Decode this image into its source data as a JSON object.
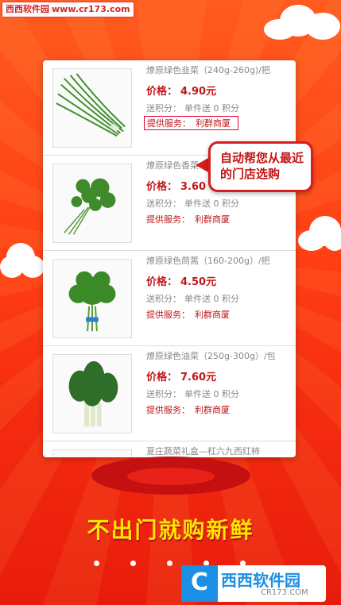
{
  "watermark": {
    "brand": "西西软件园",
    "site": "www.cr173.com"
  },
  "products": [
    {
      "name": "燎原绿色韭菜（240g-260g)/把",
      "price_label": "价格：",
      "price": "4.90元",
      "points_label": "送积分：",
      "points_value": "单件送 0 积分",
      "service_label": "提供服务：",
      "service_value": "利群商厦",
      "image_icon": "chives-image"
    },
    {
      "name": "燎原绿色香菜",
      "price_label": "价格：",
      "price": "3.60",
      "points_label": "送积分：",
      "points_value": "单件送 0 积分",
      "service_label": "提供服务：",
      "service_value": "利群商厦",
      "image_icon": "cilantro-image"
    },
    {
      "name": "燎原绿色茼蒿（160-200g）/把",
      "price_label": "价格：",
      "price": "4.50元",
      "points_label": "送积分：",
      "points_value": "单件送 0 积分",
      "service_label": "提供服务：",
      "service_value": "利群商厦",
      "image_icon": "crown-daisy-image"
    },
    {
      "name": "燎原绿色油菜（250g-300g）/包",
      "price_label": "价格：",
      "price": "7.60元",
      "points_label": "送积分：",
      "points_value": "单件送 0 积分",
      "service_label": "提供服务：",
      "service_value": "利群商厦",
      "image_icon": "bok-choy-image"
    },
    {
      "name": "夏庄蔬菜礼盒—杠六九西红柿",
      "image_icon": "gift-box-image"
    }
  ],
  "bubble": {
    "text": "自动帮您从最近的门店选购"
  },
  "slogan": "不出门就购新鲜",
  "pagination": {
    "count": 5,
    "active_index": 3
  },
  "footer_logo": {
    "mark": "C",
    "text": "西西软件园",
    "sub": "CR173.COM"
  },
  "colors": {
    "accent_red": "#c01818",
    "slogan_yellow": "#ffe600",
    "background": "#ff4a18"
  }
}
